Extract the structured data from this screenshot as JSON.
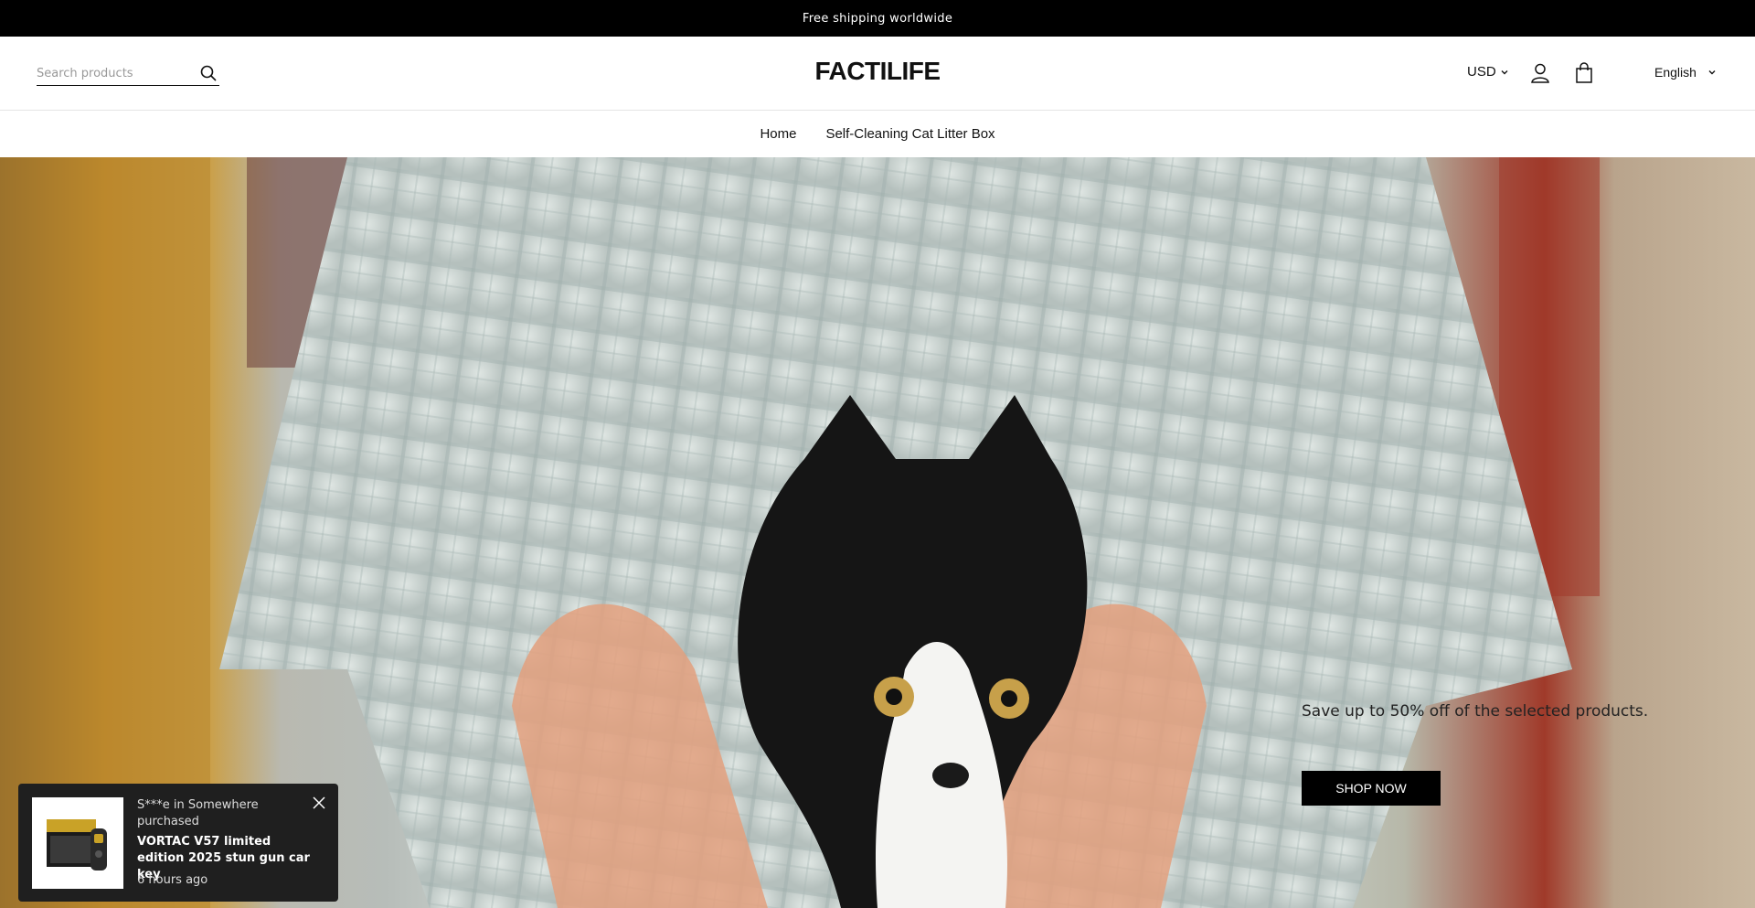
{
  "announcement": {
    "text": "Free shipping worldwide"
  },
  "header": {
    "search_placeholder": "Search products",
    "logo": "FACTILIFE",
    "currency": "USD",
    "language": "English"
  },
  "nav": {
    "items": [
      {
        "label": "Home"
      },
      {
        "label": "Self-Cleaning Cat Litter Box"
      }
    ]
  },
  "hero": {
    "promo_text": "Save up to 50% off of the selected products.",
    "button_label": "SHOP NOW"
  },
  "popup": {
    "line1": "S***e in Somewhere purchased",
    "product": "VORTAC V57 limited edition 2025 stun gun car key",
    "time": "6 hours ago"
  },
  "icons": {
    "search": "search-icon",
    "account": "account-icon",
    "cart": "cart-icon",
    "chevron": "chevron-down-icon",
    "close": "close-icon"
  }
}
